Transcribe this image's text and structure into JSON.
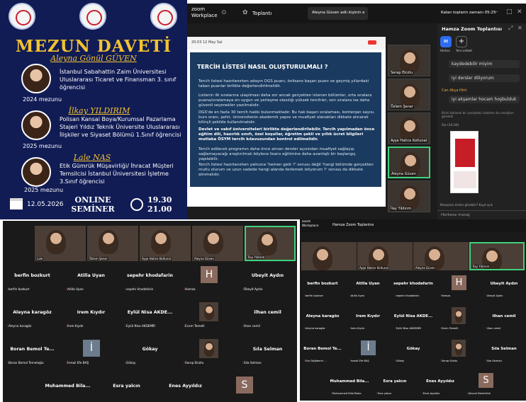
{
  "poster": {
    "title": "MEZUN DAVETİ",
    "people": [
      {
        "name": "Aleyna Gönül GÜVEN",
        "desc": "İstanbul Sabahattin Zaim Üniversitesi Uluslararası Ticaret ve Finansman 3. sınıf öğrencisi",
        "year": "2024 mezunu"
      },
      {
        "name": "İlkay YILDIRIM",
        "desc": "Polisan Kansai Boya/Kurumsal Pazarlama Stajeri Yıldız Teknik Üniversite Uluslararası İlişkiler ve Siyaset Bölümü 1.Sınıf öğrencisi",
        "year": "2025 mezunu"
      },
      {
        "name": "Lale NAS",
        "desc": "Etik Gümrük Müşavirliği/ İhracat Müşteri Temsilcisi İstanbul Üniversitesi İşletme 3.Sınıf öğrencisi",
        "year": "2025 mezunu"
      }
    ],
    "date": "12.05.2026",
    "event": "ONLINE SEMİNER",
    "time_start": "19.30",
    "time_end": "21.00"
  },
  "zoom_top": {
    "app": "zoom Workplace",
    "tab_meetings": "Toplantı",
    "tab_screen": "Aleyna Güven adlı kişinin ekranı",
    "time_left": "Kalan toplantı zamanı 05:25",
    "slide_date": "20:03 12 May Sal",
    "slide_title": "TERCİH LİSTESİ NASIL OLUŞTURULMALI ?",
    "bullets": [
      "Tercih listesi hazırlanırken adayın DGS puanı, önlisans başarı puanı ve geçmiş yıllardaki taban puanlar birlikte değerlendirilmelidir.",
      "Listenin ilk sıralarına ulaşılması daha zor ancak gerçekten istenen bölümler, orta sıralara puana/sıralamaya en uygun ve yerleşme olasılığı yüksek tercihler, son sıralara ise daha güvenli seçenekler yazılmalıdır.",
      "DGS'de en fazla 30 tercih hakkı bulunmaktadır. Bu hak başarı sıralaması, kontenjan sayısı, burs oranı, şehir, üniversitenin akademik yapısı ve muafiyet olanakları dikkate alınarak bilinçli şekilde kullanılmalıdır.",
      "Devlet ve vakıf üniversiteleri birlikte değerlendirilebilir. Tercih yapılmadan önce eğitim dili, hazırlık sınıfı, özel koşullar, öğretim şekli ve yıllık ücret bilgileri mutlaka ÖSYM tercih kılavuzundan kontrol edilmelidir.",
      "Tercih edilecek programın daha önce alınan dersler açısından muafiyet sağlayıp sağlamayacağı araştırılmalı böylece lisans eğitimine daha avantajlı bir başlangıç yapılabilir.",
      "Tercih listesi hazırlanırken yalnızca 'hemen gelir ?' sorusu değil 'hangi bölümde gerçekten mutlu olurum ve uzun vadede hangi alanda ilerlemek istiyorum ?' sorusu da dikkate alınmalıdır."
    ],
    "thumbs": [
      "Serap Ekiztu",
      "Özlem Şener",
      "Ayşe Hatice Koltunal",
      "Aleyna Güven",
      "İlay Yıldırım"
    ],
    "chat_title": "Hamza Zoom Toplantısı",
    "chat_tab1": "Herkes",
    "chat_tab2": "Yeni sohbet",
    "chat_msgs": [
      "kaydedebilir miyim",
      "iyi dersler diliyorum",
      "Can Akça Hint",
      "iyi akşamlar hocam hoşbulduk",
      "Birini kullanan bir yavaşlatıcı katılımcı bu mesajları görebilir",
      "Siz (14:30)"
    ],
    "chat_placeholder": "Herkese mesaj",
    "chat_who": "Mesajınızı kimler görebilir? Kayıt açık"
  },
  "gallery_left": {
    "thumbs": [
      "Lale",
      "Özlem Şener",
      "Ayşe Hatice Koltunal",
      "Aleyna Güven",
      "İlay Yıldırım"
    ],
    "rows": [
      [
        {
          "name": "berfin bozkurt",
          "label": "berfin bozkurt"
        },
        {
          "name": "Atilla Uyan",
          "label": "Atilla Uyan"
        },
        {
          "name": "sepehr khodafarin",
          "label": "sepehr khodafarin"
        },
        {
          "avatar": "H",
          "label": "Hamza"
        },
        {
          "name": "Übeyit Aydın",
          "label": "Übeyit Aydın"
        }
      ],
      [
        {
          "name": "Aleyna karagöz",
          "label": "Aleyna karagöz"
        },
        {
          "name": "İrem Kıydır",
          "label": "İrem Kıydır"
        },
        {
          "name": "Eylül Nisa AKDE...",
          "label": "Eylül Nisa AKDEMİR"
        },
        {
          "video": "1",
          "label": "Ecem Temelli"
        },
        {
          "name": "ilhan cemil",
          "label": "ilhan cemil"
        }
      ],
      [
        {
          "name": "Boran Bemol Te...",
          "label": "Boran Bemol Temeloğlu"
        },
        {
          "avatar": "İ",
          "label": "İsmail Efe BAŞ"
        },
        {
          "name": "Gökay",
          "label": "Gökay"
        },
        {
          "video": "2",
          "label": "Serap Ekiztu"
        },
        {
          "name": "Sıla Selman",
          "label": "Sıla Selman"
        }
      ],
      [
        {
          "name": "Muhammed Bila...",
          "label": ""
        },
        {
          "name": "Esra yalcın",
          "label": ""
        },
        {
          "name": "Enes Ayyıldız",
          "label": ""
        },
        {
          "avatar": "S",
          "label": ""
        }
      ]
    ]
  },
  "gallery_right": {
    "app": "zoom Workplace",
    "meeting": "Hamza Zoom Toplantısı",
    "thumbs": [
      "",
      "Ayşe Hatice Koltunal",
      "Aleyna Güven",
      "İlay Yıldırım"
    ],
    "rows": [
      [
        {
          "name": "berfin bozkurt",
          "label": "berfin bozkurt"
        },
        {
          "name": "Atilla Uyan",
          "label": "Atilla Uyan"
        },
        {
          "name": "sepehr khodafarin",
          "label": "sepehr khodafarin"
        },
        {
          "avatar": "H",
          "label": "Hamza"
        },
        {
          "name": "Übeyit Aydın",
          "label": "Übeyit Aydın"
        }
      ],
      [
        {
          "name": "Aleyna karagöz",
          "label": "Aleyna karagöz"
        },
        {
          "name": "İrem Kıydır",
          "label": "İrem Kıydır"
        },
        {
          "name": "Eylül Nisa AKDE...",
          "label": "Eylül Nisa AKDEMİR"
        },
        {
          "video": "1",
          "label": "Ecem Temelli"
        },
        {
          "name": "ilhan cemil",
          "label": "ilhan cemil"
        }
      ],
      [
        {
          "name": "Boran Bemol Te...",
          "label": "Ece Dağdemir ..."
        },
        {
          "avatar": "İ",
          "label": "İsmail Efe BAŞ"
        },
        {
          "name": "Gökay",
          "label": "Gökay"
        },
        {
          "video": "2",
          "label": "Serap Ekiztu"
        },
        {
          "name": "Sıla Selman",
          "label": "Sıla Selman"
        }
      ],
      [
        {
          "name": "Muhammed Bila...",
          "label": "Muhammed Bilal Batur"
        },
        {
          "name": "Esra yalcın",
          "label": "Esra yalcın"
        },
        {
          "name": "Enes Ayyıldız",
          "label": "Enes Ayyıldız"
        },
        {
          "avatar": "S",
          "label": "Şevval Demirtürk"
        }
      ]
    ]
  }
}
